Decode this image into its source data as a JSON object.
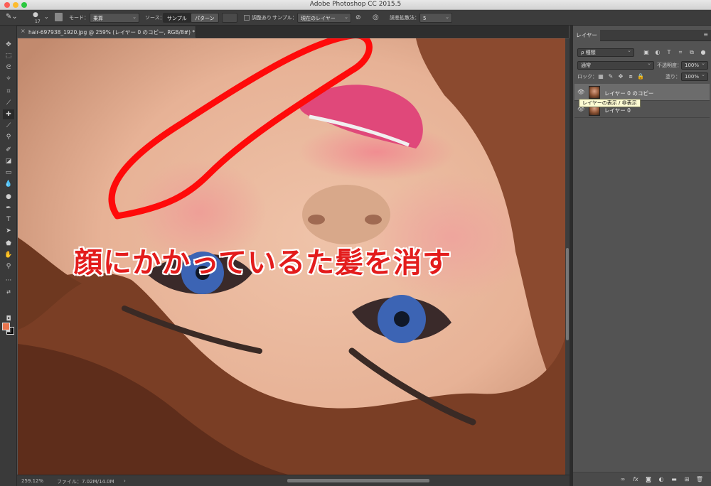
{
  "app": {
    "title": "Adobe Photoshop CC 2015.5"
  },
  "options": {
    "brush_size": "17",
    "mode_label": "モード：",
    "mode_value": "乗算",
    "source_label": "ソース：",
    "source_sampled": "サンプル",
    "source_pattern": "パターン",
    "aligned_label": "調整あり",
    "sample_label": "サンプル：",
    "sample_value": "現在のレイヤー",
    "diffusion_label": "誤差拡散法：",
    "diffusion_value": "5"
  },
  "document": {
    "tab_title": "hair-697938_1920.jpg @ 259% (レイヤー 0 のコピー, RGB/8#) *",
    "close_glyph": "×"
  },
  "status": {
    "zoom": "259.12%",
    "file": "ファイル：7.02M/14.0M",
    "arrow": "›"
  },
  "caption": {
    "text": "顔にかかっているた髪を消す",
    "color": "#e31c1c"
  },
  "annotation": {
    "stroke_color": "#ff0a0a"
  },
  "layers_panel": {
    "tab": "レイヤー",
    "menu_glyph": "≡",
    "filter_label": "ρ 種類",
    "blend_mode": "通常",
    "opacity_label": "不透明度：",
    "opacity_value": "100%",
    "lock_label": "ロック：",
    "fill_label": "塗り：",
    "fill_value": "100%",
    "tooltip": "レイヤーの表示 / 非表示",
    "layers": [
      {
        "name": "レイヤー 0 のコピー",
        "selected": true
      },
      {
        "name": "レイヤー 0",
        "selected": false
      }
    ]
  }
}
